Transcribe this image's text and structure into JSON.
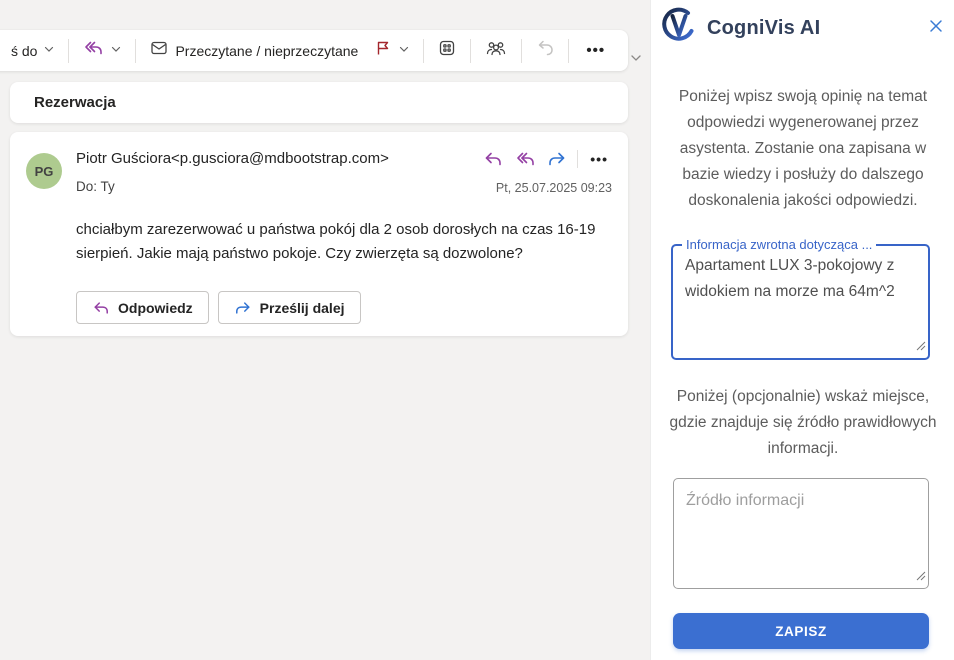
{
  "toolbar": {
    "move_to_label": "ś do",
    "read_unread_label": "Przeczytane / nieprzeczytane",
    "overflow_label": "•••"
  },
  "email": {
    "subject": "Rezerwacja",
    "avatar_initials": "PG",
    "sender": "Piotr Guściora<p.gusciora@mdbootstrap.com>",
    "to_label": "Do:  Ty",
    "date": "Pt, 25.07.2025 09:23",
    "body": "chciałbym zarezerwować u państwa pokój dla 2 osob dorosłych na czas 16-19 sierpień. Jakie mają państwo pokoje. Czy zwierzęta są dozwolone?",
    "reply_button": "Odpowiedz",
    "forward_button": "Prześlij dalej",
    "overflow_label": "•••"
  },
  "panel": {
    "title": "CogniVis AI",
    "intro": "Poniżej wpisz swoją opinię na temat odpowiedzi wygenerowanej przez asystenta. Zostanie ona zapisana w bazie wiedzy i posłuży do dalszego doskonalenia jakości odpowiedzi.",
    "feedback_label": "Informacja zwrotna dotycząca ...",
    "feedback_value": "Apartament LUX 3-pokojowy z widokiem na morze ma 64m^2",
    "source_hint": "Poniżej (opcjonalnie) wskaż miejsce, gdzie znajduje się źródło prawidłowych informacji.",
    "source_placeholder": "Źródło informacji",
    "save_button": "ZAPISZ"
  },
  "icons": {
    "chevron_down": "∨",
    "close": "✕",
    "reply": "curved-left-arrow",
    "reply_all": "double-curved-left-arrow",
    "forward": "curved-right-arrow",
    "flag": "flag-outline",
    "read_unread": "envelope-outline",
    "apps_grid": "grid-dots",
    "people": "group-outline",
    "undo": "undo-arrow"
  },
  "colors": {
    "accent_purple": "#9440a4",
    "accent_blue": "#3173d2",
    "flag_red": "#a4262c",
    "panel_accent": "#3864c8",
    "save_button_bg": "#3b6fd1",
    "avatar_bg": "#aecb8f",
    "background": "#f3f2f1"
  }
}
